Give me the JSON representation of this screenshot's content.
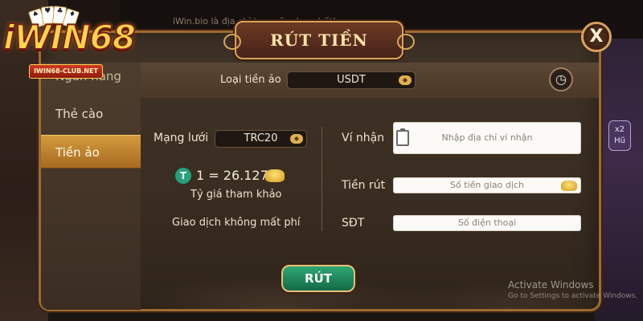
{
  "background": {
    "topbar_text": "iWin.bio là địa chỉ truy cập duy nhất!",
    "right_badge": "x2 Hũ"
  },
  "logo": {
    "text": "iWIN68",
    "ribbon": "IWIN68-CLUB.NET"
  },
  "dialog": {
    "title": "RÚT TIỀN",
    "close_label": "X",
    "sidebar": [
      {
        "label": "Ngân hàng",
        "active": false
      },
      {
        "label": "Thẻ cào",
        "active": false
      },
      {
        "label": "Tiền ảo",
        "active": true
      }
    ],
    "crypto_type": {
      "label": "Loại tiền ảo",
      "value": "USDT"
    },
    "network": {
      "label": "Mạng lưới",
      "value": "TRC20"
    },
    "rate": {
      "coin_symbol": "T",
      "value": "1 = 26.127",
      "note": "Tỷ giá tham khảo"
    },
    "fee_note": "Giao dịch không mất phí",
    "form": {
      "wallet_label": "Ví nhận",
      "wallet_placeholder": "Nhập địa chỉ ví nhận",
      "amount_label": "Tiền rút",
      "amount_placeholder": "Số tiền giao dịch",
      "phone_label": "SĐT",
      "phone_placeholder": "Số điện thoại"
    },
    "submit_label": "RÚT"
  },
  "watermark": {
    "line1": "Activate Windows",
    "line2": "Go to Settings to activate Windows."
  },
  "colors": {
    "accent": "#d39b3c",
    "submit": "#2ea872",
    "border": "#a06a30"
  },
  "icons": {
    "history": "history-clock-icon",
    "clipboard": "clipboard-icon",
    "coin": "tether-coin-icon",
    "gold": "gold-ingot-icon"
  }
}
